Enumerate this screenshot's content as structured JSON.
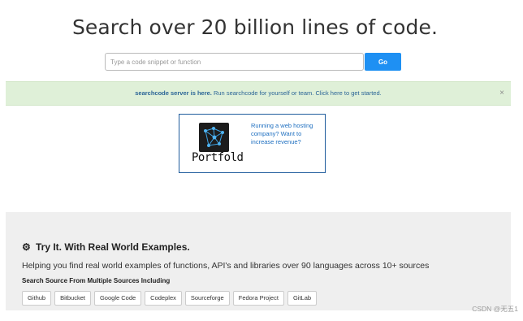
{
  "hero": {
    "title": "Search over 20 billion lines of code."
  },
  "search": {
    "placeholder": "Type a code snippet or function",
    "go_label": "Go"
  },
  "banner": {
    "strong": "searchcode server is here.",
    "rest": " Run searchcode for yourself or team. Click here to get started.",
    "close": "×"
  },
  "ad": {
    "logo_word": "Portfold",
    "text": "Running a web hosting company? Want to increase revenue?"
  },
  "features": {
    "icon": "gear-icon",
    "title": "Try It. With Real World Examples.",
    "description": "Helping you find real world examples of functions, API's and libraries over 90 languages across 10+ sources",
    "subtitle": "Search Source From Multiple Sources Including",
    "sources": [
      "Github",
      "Bitbucket",
      "Google Code",
      "Codeplex",
      "Sourceforge",
      "Fedora Project",
      "GitLab"
    ]
  },
  "watermark": "CSDN @无五1",
  "colors": {
    "accent": "#1e90f3",
    "banner_bg": "#dff0d8",
    "link": "#2a6496",
    "features_bg": "#efefef"
  }
}
